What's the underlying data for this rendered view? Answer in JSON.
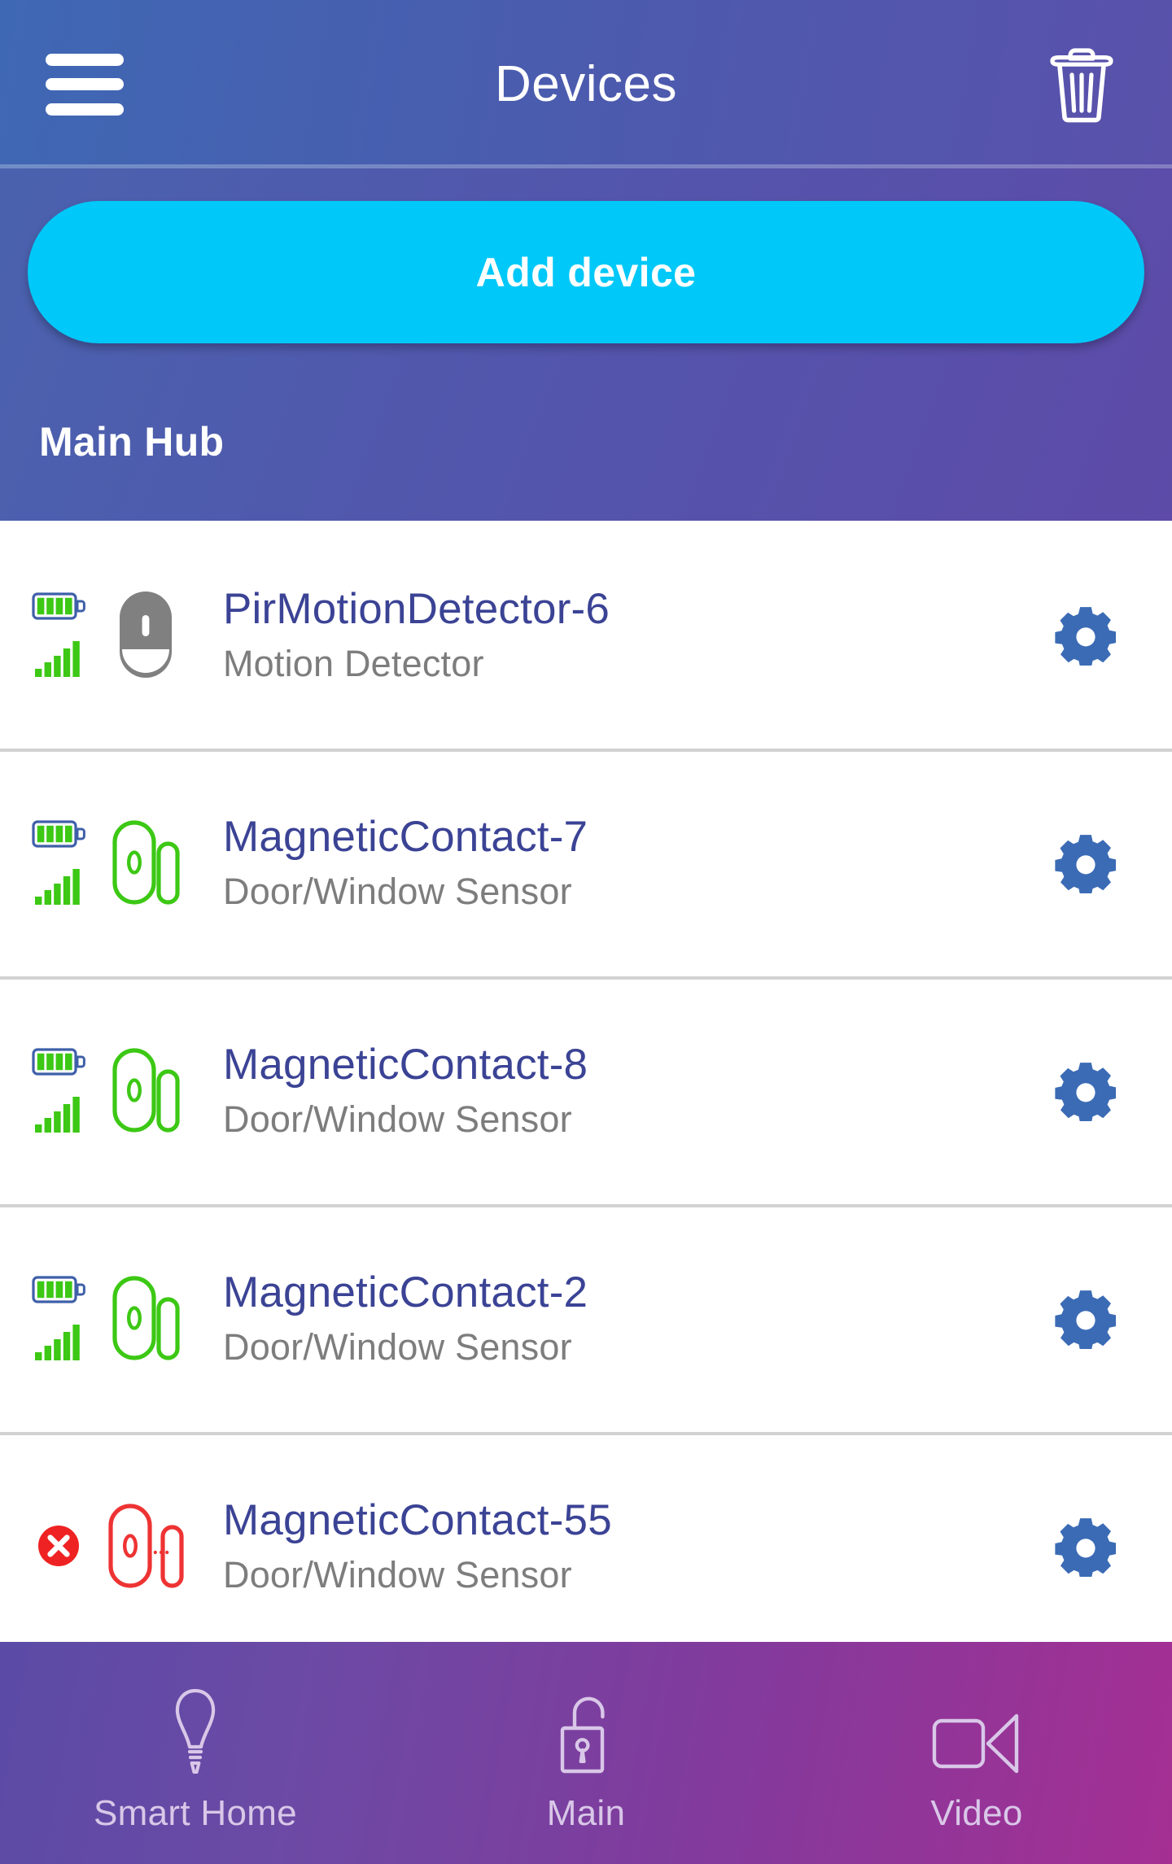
{
  "header": {
    "title": "Devices",
    "menu_icon": "hamburger-menu-icon",
    "delete_icon": "trash-icon"
  },
  "promo": {
    "add_device_label": "Add device",
    "section_title": "Main Hub"
  },
  "colors": {
    "accent_cyan": "#00c8f8",
    "header_blue": "#4a5cae",
    "device_name_blue": "#3b4395",
    "device_type_gray": "#7d7d7d",
    "gear_blue": "#3b6bb5",
    "status_ok_green": "#3cc814",
    "status_error_red": "#ee2222",
    "row_divider_gray": "#d2d2d2",
    "nav_gradient_start": "#5b4ba6",
    "nav_gradient_end": "#a52f93"
  },
  "devices": [
    {
      "name": "PirMotionDetector-6",
      "type": "Motion Detector",
      "icon": "motion-detector-icon",
      "status": "online",
      "battery_level": 4,
      "signal_level": 5,
      "settings_icon": "gear-icon"
    },
    {
      "name": "MagneticContact-7",
      "type": "Door/Window Sensor",
      "icon": "magnetic-contact-icon",
      "status": "online",
      "battery_level": 4,
      "signal_level": 5,
      "settings_icon": "gear-icon"
    },
    {
      "name": "MagneticContact-8",
      "type": "Door/Window Sensor",
      "icon": "magnetic-contact-icon",
      "status": "online",
      "battery_level": 4,
      "signal_level": 5,
      "settings_icon": "gear-icon"
    },
    {
      "name": "MagneticContact-2",
      "type": "Door/Window Sensor",
      "icon": "magnetic-contact-icon",
      "status": "online",
      "battery_level": 4,
      "signal_level": 5,
      "settings_icon": "gear-icon"
    },
    {
      "name": "MagneticContact-55",
      "type": "Door/Window Sensor",
      "icon": "magnetic-contact-offline-icon",
      "status": "offline",
      "battery_level": 0,
      "signal_level": 0,
      "settings_icon": "gear-icon"
    }
  ],
  "bottom_nav": [
    {
      "label": "Smart Home",
      "icon": "lightbulb-icon"
    },
    {
      "label": "Main",
      "icon": "unlocked-padlock-icon"
    },
    {
      "label": "Video",
      "icon": "video-camera-icon"
    }
  ]
}
